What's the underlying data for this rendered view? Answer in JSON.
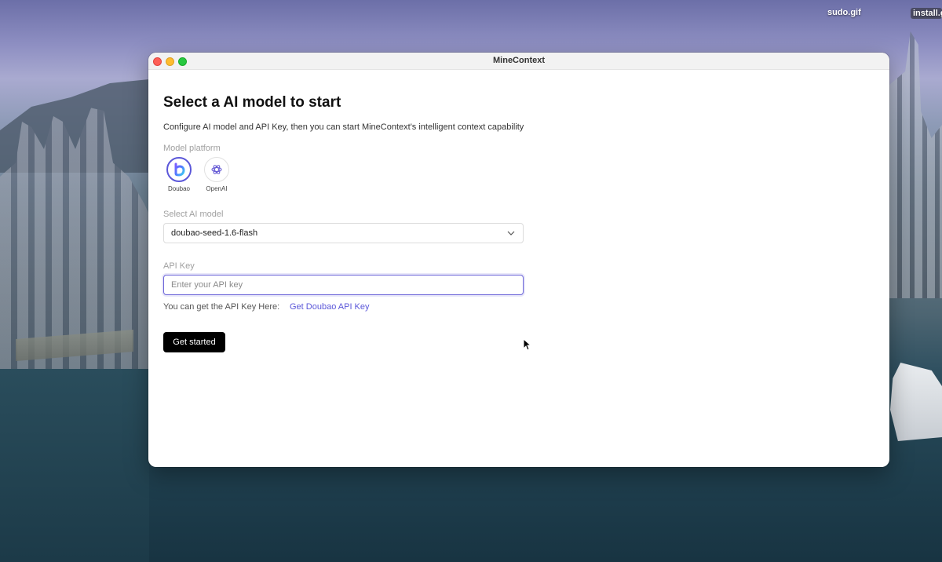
{
  "desktop": {
    "files": [
      {
        "name": "sudo.gif",
        "icon": "file-icon"
      },
      {
        "name": "install.gif",
        "icon": "file-icon"
      }
    ]
  },
  "window": {
    "title": "MineContext"
  },
  "setup": {
    "title": "Select a AI model to start",
    "subtitle": "Configure AI model and API Key, then you can start MineContext's intelligent context capability",
    "platform_label": "Model platform",
    "platforms": [
      {
        "name": "Doubao",
        "icon": "doubao-logo-icon",
        "selected": true
      },
      {
        "name": "OpenAI",
        "icon": "openai-logo-icon",
        "selected": false
      }
    ],
    "model_label": "Select AI model",
    "model_value": "doubao-seed-1.6-flash",
    "api_key_label": "API Key",
    "api_key_placeholder": "Enter your API key",
    "api_key_value": "",
    "hint_text": "You can get the API Key Here:",
    "hint_link": "Get Doubao API Key",
    "submit_label": "Get started"
  },
  "colors": {
    "accent": "#5b57d9",
    "button_bg": "#000000"
  }
}
